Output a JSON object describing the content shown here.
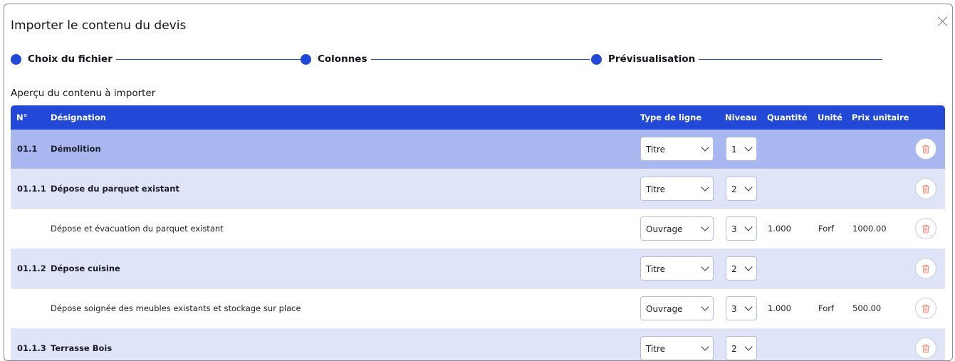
{
  "dialog": {
    "title": "Importer le contenu du devis"
  },
  "steps": [
    {
      "label": "Choix du fichier"
    },
    {
      "label": "Colonnes"
    },
    {
      "label": "Prévisualisation"
    }
  ],
  "section_title": "Aperçu du contenu à importer",
  "columns": {
    "num": "N°",
    "designation": "Désignation",
    "type": "Type de ligne",
    "niveau": "Niveau",
    "quantite": "Quantité",
    "unite": "Unité",
    "prix": "Prix unitaire"
  },
  "rows": [
    {
      "num": "01.1",
      "designation": "Démolition",
      "type": "Titre",
      "niveau": "1",
      "quantite": "",
      "unite": "",
      "prix": ""
    },
    {
      "num": "01.1.1",
      "designation": "Dépose du parquet existant",
      "type": "Titre",
      "niveau": "2",
      "quantite": "",
      "unite": "",
      "prix": ""
    },
    {
      "num": "",
      "designation": "Dépose et évacuation du parquet existant",
      "type": "Ouvrage",
      "niveau": "3",
      "quantite": "1.000",
      "unite": "Forf",
      "prix": "1000.00"
    },
    {
      "num": "01.1.2",
      "designation": "Dépose cuisine",
      "type": "Titre",
      "niveau": "2",
      "quantite": "",
      "unite": "",
      "prix": ""
    },
    {
      "num": "",
      "designation": "Dépose soignée des meubles existants et stockage sur place",
      "type": "Ouvrage",
      "niveau": "3",
      "quantite": "1.000",
      "unite": "Forf",
      "prix": "500.00"
    },
    {
      "num": "01.1.3",
      "designation": "Terrasse Bois",
      "type": "Titre",
      "niveau": "2",
      "quantite": "",
      "unite": "",
      "prix": ""
    }
  ],
  "colors": {
    "primary": "#2148d6",
    "level1_bg": "#a8b7f0",
    "level2_bg": "#dfe4f9",
    "delete_icon": "#f08a7e"
  },
  "icons": {
    "close": "close-icon",
    "delete": "trash-icon",
    "dropdown": "chevron-down-icon"
  }
}
